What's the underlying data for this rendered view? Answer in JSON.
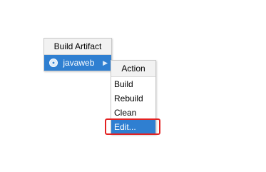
{
  "menu1": {
    "title": "Build Artifact",
    "items": [
      {
        "label": "javaweb",
        "icon": "artifact-icon",
        "has_submenu": true
      }
    ]
  },
  "submenu": {
    "title": "Action",
    "items": [
      {
        "label": "Build"
      },
      {
        "label": "Rebuild"
      },
      {
        "label": "Clean"
      },
      {
        "label": "Edit...",
        "selected": true
      }
    ]
  },
  "colors": {
    "selection": "#2f7fd1",
    "highlight_box": "#e32222",
    "menu_header_bg": "#f2f2f2",
    "border": "#c9c9c9"
  }
}
